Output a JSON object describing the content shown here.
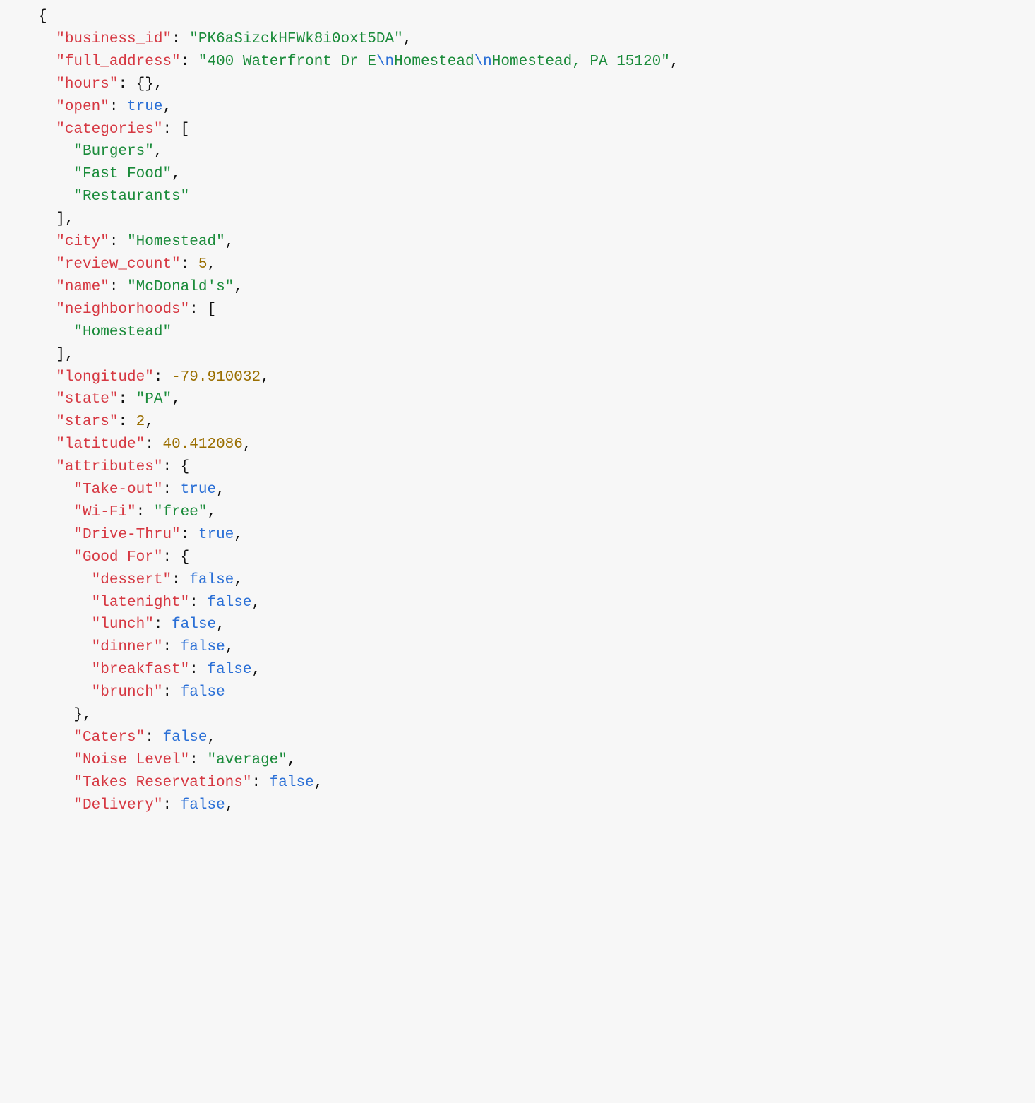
{
  "tokens": [
    {
      "cls": "p",
      "txt": "{"
    },
    {
      "br": true
    },
    {
      "sp": 2
    },
    {
      "cls": "k",
      "txt": "\"business_id\""
    },
    {
      "cls": "p",
      "txt": ": "
    },
    {
      "cls": "s",
      "txt": "\"PK6aSizckHFWk8i0oxt5DA\""
    },
    {
      "cls": "p",
      "txt": ","
    },
    {
      "br": true
    },
    {
      "sp": 2
    },
    {
      "cls": "k",
      "txt": "\"full_address\""
    },
    {
      "cls": "p",
      "txt": ": "
    },
    {
      "cls": "s",
      "txt": "\"400 Waterfront Dr E"
    },
    {
      "cls": "e",
      "txt": "\\n"
    },
    {
      "cls": "s",
      "txt": "Homestead"
    },
    {
      "cls": "e",
      "txt": "\\n"
    },
    {
      "cls": "s",
      "txt": "Homestead, PA 15120\""
    },
    {
      "cls": "p",
      "txt": ","
    },
    {
      "br": true
    },
    {
      "sp": 2
    },
    {
      "cls": "k",
      "txt": "\"hours\""
    },
    {
      "cls": "p",
      "txt": ": {},"
    },
    {
      "br": true
    },
    {
      "sp": 2
    },
    {
      "cls": "k",
      "txt": "\"open\""
    },
    {
      "cls": "p",
      "txt": ": "
    },
    {
      "cls": "b",
      "txt": "true"
    },
    {
      "cls": "p",
      "txt": ","
    },
    {
      "br": true
    },
    {
      "sp": 2
    },
    {
      "cls": "k",
      "txt": "\"categories\""
    },
    {
      "cls": "p",
      "txt": ": ["
    },
    {
      "br": true
    },
    {
      "sp": 4
    },
    {
      "cls": "s",
      "txt": "\"Burgers\""
    },
    {
      "cls": "p",
      "txt": ","
    },
    {
      "br": true
    },
    {
      "sp": 4
    },
    {
      "cls": "s",
      "txt": "\"Fast Food\""
    },
    {
      "cls": "p",
      "txt": ","
    },
    {
      "br": true
    },
    {
      "sp": 4
    },
    {
      "cls": "s",
      "txt": "\"Restaurants\""
    },
    {
      "br": true
    },
    {
      "sp": 2
    },
    {
      "cls": "p",
      "txt": "],"
    },
    {
      "br": true
    },
    {
      "sp": 2
    },
    {
      "cls": "k",
      "txt": "\"city\""
    },
    {
      "cls": "p",
      "txt": ": "
    },
    {
      "cls": "s",
      "txt": "\"Homestead\""
    },
    {
      "cls": "p",
      "txt": ","
    },
    {
      "br": true
    },
    {
      "sp": 2
    },
    {
      "cls": "k",
      "txt": "\"review_count\""
    },
    {
      "cls": "p",
      "txt": ": "
    },
    {
      "cls": "n",
      "txt": "5"
    },
    {
      "cls": "p",
      "txt": ","
    },
    {
      "br": true
    },
    {
      "sp": 2
    },
    {
      "cls": "k",
      "txt": "\"name\""
    },
    {
      "cls": "p",
      "txt": ": "
    },
    {
      "cls": "s",
      "txt": "\"McDonald's\""
    },
    {
      "cls": "p",
      "txt": ","
    },
    {
      "br": true
    },
    {
      "sp": 2
    },
    {
      "cls": "k",
      "txt": "\"neighborhoods\""
    },
    {
      "cls": "p",
      "txt": ": ["
    },
    {
      "br": true
    },
    {
      "sp": 4
    },
    {
      "cls": "s",
      "txt": "\"Homestead\""
    },
    {
      "br": true
    },
    {
      "sp": 2
    },
    {
      "cls": "p",
      "txt": "],"
    },
    {
      "br": true
    },
    {
      "sp": 2
    },
    {
      "cls": "k",
      "txt": "\"longitude\""
    },
    {
      "cls": "p",
      "txt": ": "
    },
    {
      "cls": "n",
      "txt": "-79.910032"
    },
    {
      "cls": "p",
      "txt": ","
    },
    {
      "br": true
    },
    {
      "sp": 2
    },
    {
      "cls": "k",
      "txt": "\"state\""
    },
    {
      "cls": "p",
      "txt": ": "
    },
    {
      "cls": "s",
      "txt": "\"PA\""
    },
    {
      "cls": "p",
      "txt": ","
    },
    {
      "br": true
    },
    {
      "sp": 2
    },
    {
      "cls": "k",
      "txt": "\"stars\""
    },
    {
      "cls": "p",
      "txt": ": "
    },
    {
      "cls": "n",
      "txt": "2"
    },
    {
      "cls": "p",
      "txt": ","
    },
    {
      "br": true
    },
    {
      "sp": 2
    },
    {
      "cls": "k",
      "txt": "\"latitude\""
    },
    {
      "cls": "p",
      "txt": ": "
    },
    {
      "cls": "n",
      "txt": "40.412086"
    },
    {
      "cls": "p",
      "txt": ","
    },
    {
      "br": true
    },
    {
      "sp": 2
    },
    {
      "cls": "k",
      "txt": "\"attributes\""
    },
    {
      "cls": "p",
      "txt": ": {"
    },
    {
      "br": true
    },
    {
      "sp": 4
    },
    {
      "cls": "k",
      "txt": "\"Take-out\""
    },
    {
      "cls": "p",
      "txt": ": "
    },
    {
      "cls": "b",
      "txt": "true"
    },
    {
      "cls": "p",
      "txt": ","
    },
    {
      "br": true
    },
    {
      "sp": 4
    },
    {
      "cls": "k",
      "txt": "\"Wi-Fi\""
    },
    {
      "cls": "p",
      "txt": ": "
    },
    {
      "cls": "s",
      "txt": "\"free\""
    },
    {
      "cls": "p",
      "txt": ","
    },
    {
      "br": true
    },
    {
      "sp": 4
    },
    {
      "cls": "k",
      "txt": "\"Drive-Thru\""
    },
    {
      "cls": "p",
      "txt": ": "
    },
    {
      "cls": "b",
      "txt": "true"
    },
    {
      "cls": "p",
      "txt": ","
    },
    {
      "br": true
    },
    {
      "sp": 4
    },
    {
      "cls": "k",
      "txt": "\"Good For\""
    },
    {
      "cls": "p",
      "txt": ": {"
    },
    {
      "br": true
    },
    {
      "sp": 6
    },
    {
      "cls": "k",
      "txt": "\"dessert\""
    },
    {
      "cls": "p",
      "txt": ": "
    },
    {
      "cls": "b",
      "txt": "false"
    },
    {
      "cls": "p",
      "txt": ","
    },
    {
      "br": true
    },
    {
      "sp": 6
    },
    {
      "cls": "k",
      "txt": "\"latenight\""
    },
    {
      "cls": "p",
      "txt": ": "
    },
    {
      "cls": "b",
      "txt": "false"
    },
    {
      "cls": "p",
      "txt": ","
    },
    {
      "br": true
    },
    {
      "sp": 6
    },
    {
      "cls": "k",
      "txt": "\"lunch\""
    },
    {
      "cls": "p",
      "txt": ": "
    },
    {
      "cls": "b",
      "txt": "false"
    },
    {
      "cls": "p",
      "txt": ","
    },
    {
      "br": true
    },
    {
      "sp": 6
    },
    {
      "cls": "k",
      "txt": "\"dinner\""
    },
    {
      "cls": "p",
      "txt": ": "
    },
    {
      "cls": "b",
      "txt": "false"
    },
    {
      "cls": "p",
      "txt": ","
    },
    {
      "br": true
    },
    {
      "sp": 6
    },
    {
      "cls": "k",
      "txt": "\"breakfast\""
    },
    {
      "cls": "p",
      "txt": ": "
    },
    {
      "cls": "b",
      "txt": "false"
    },
    {
      "cls": "p",
      "txt": ","
    },
    {
      "br": true
    },
    {
      "sp": 6
    },
    {
      "cls": "k",
      "txt": "\"brunch\""
    },
    {
      "cls": "p",
      "txt": ": "
    },
    {
      "cls": "b",
      "txt": "false"
    },
    {
      "br": true
    },
    {
      "sp": 4
    },
    {
      "cls": "p",
      "txt": "},"
    },
    {
      "br": true
    },
    {
      "sp": 4
    },
    {
      "cls": "k",
      "txt": "\"Caters\""
    },
    {
      "cls": "p",
      "txt": ": "
    },
    {
      "cls": "b",
      "txt": "false"
    },
    {
      "cls": "p",
      "txt": ","
    },
    {
      "br": true
    },
    {
      "sp": 4
    },
    {
      "cls": "k",
      "txt": "\"Noise Level\""
    },
    {
      "cls": "p",
      "txt": ": "
    },
    {
      "cls": "s",
      "txt": "\"average\""
    },
    {
      "cls": "p",
      "txt": ","
    },
    {
      "br": true
    },
    {
      "sp": 4
    },
    {
      "cls": "k",
      "txt": "\"Takes Reservations\""
    },
    {
      "cls": "p",
      "txt": ": "
    },
    {
      "cls": "b",
      "txt": "false"
    },
    {
      "cls": "p",
      "txt": ","
    },
    {
      "br": true
    },
    {
      "sp": 4
    },
    {
      "cls": "k",
      "txt": "\"Delivery\""
    },
    {
      "cls": "p",
      "txt": ": "
    },
    {
      "cls": "b",
      "txt": "false"
    },
    {
      "cls": "p",
      "txt": ","
    }
  ]
}
